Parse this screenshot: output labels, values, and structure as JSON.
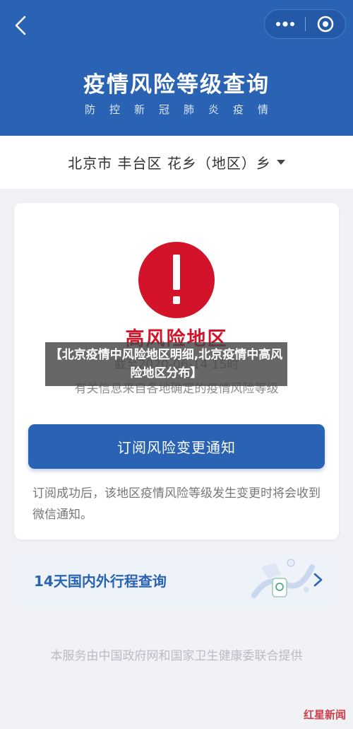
{
  "header": {
    "title": "疫情风险等级查询",
    "subtitle": "防控新冠肺炎疫情",
    "back_icon": "chevron-left-icon",
    "more_icon": "more-dots-icon",
    "close_icon": "target-close-icon",
    "color": "#2a63b4"
  },
  "location": {
    "text": "北京市 丰台区 花乡（地区）乡"
  },
  "risk_card": {
    "icon": "exclamation-icon",
    "level": "高风险地区",
    "update_time": "截至2020-06-14 15时",
    "source": "有关信息来自各地确定的疫情风险等级",
    "subscribe_button": "订阅风险变更通知",
    "subscribe_note": "订阅成功后，该地区疫情风险等级发生变更时将会收到微信通知。",
    "level_color": "#d3132a"
  },
  "travel_card": {
    "label": "14天国内外行程查询"
  },
  "footer": {
    "note": "本服务由中国政府网和国家卫生健康委联合提供"
  },
  "watermark": {
    "banner": "【北京疫情中风险地区明细,北京疫情中高风险地区分布】",
    "brand": "红星新闻"
  }
}
